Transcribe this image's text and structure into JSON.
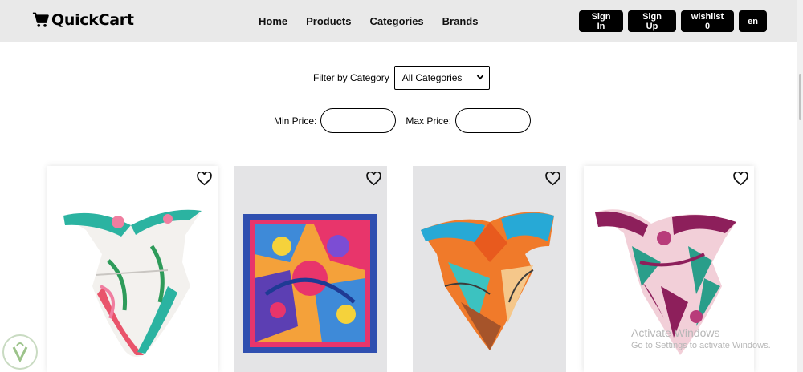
{
  "header": {
    "brand": "QuickCart",
    "nav": [
      "Home",
      "Products",
      "Categories",
      "Brands"
    ],
    "actions": {
      "sign_in": "Sign In",
      "sign_up": "Sign Up",
      "wishlist": "wishlist 0",
      "language": "en"
    }
  },
  "filters": {
    "category_label": "Filter by Category",
    "category_selected": "All Categories",
    "min_price_label": "Min Price:",
    "max_price_label": "Max Price:"
  },
  "products": [
    {
      "image": "white-floral-scarf",
      "wishlist_icon": "heart-icon"
    },
    {
      "image": "blue-pink-square-scarf",
      "wishlist_icon": "heart-icon"
    },
    {
      "image": "orange-teal-scarf",
      "wishlist_icon": "heart-icon"
    },
    {
      "image": "magenta-floral-scarf",
      "wishlist_icon": "heart-icon"
    }
  ],
  "watermark": {
    "title": "Activate Windows",
    "subtitle": "Go to Settings to activate Windows."
  },
  "colors": {
    "header_bg": "#e9e9e9",
    "button_bg": "#000000",
    "button_text": "#ffffff"
  }
}
